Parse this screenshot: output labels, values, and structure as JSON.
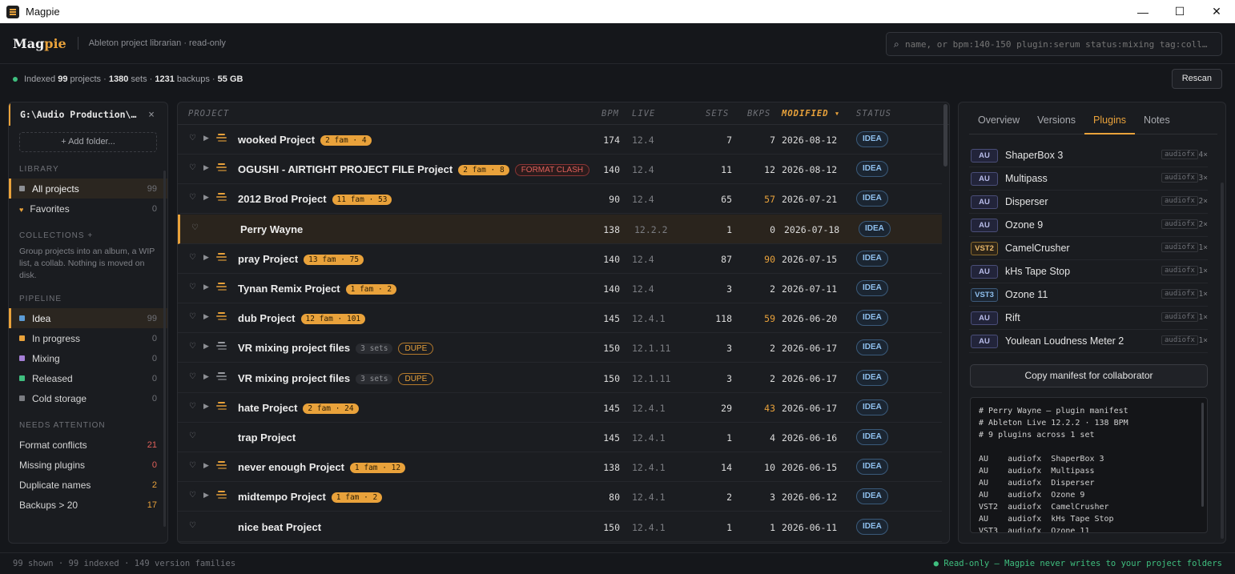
{
  "window": {
    "title": "Magpie",
    "minimize": "—",
    "maximize": "☐",
    "close": "✕"
  },
  "header": {
    "logo_main": "Mag",
    "logo_accent": "pie",
    "tagline": "Ableton project librarian · read-only",
    "search_placeholder": "name, or bpm:140-150 plugin:serum status:mixing tag:coll…"
  },
  "status": {
    "indexed_label": "Indexed",
    "projects": "99",
    "projects_label": "projects ·",
    "sets": "1380",
    "sets_label": "sets ·",
    "backups": "1231",
    "backups_label": "backups ·",
    "size": "55 GB",
    "rescan": "Rescan"
  },
  "sidebar": {
    "folder": "G:\\Audio Production\\…",
    "add_folder": "+ Add folder...",
    "library_head": "LIBRARY",
    "library": [
      {
        "label": "All projects",
        "count": "99"
      },
      {
        "label": "Favorites",
        "count": "0"
      }
    ],
    "collections_head": "COLLECTIONS +",
    "collections_desc": "Group projects into an album, a WIP list, a collab. Nothing is moved on disk.",
    "pipeline_head": "PIPELINE",
    "pipeline": [
      {
        "label": "Idea",
        "count": "99",
        "color": "#5b9bd5"
      },
      {
        "label": "In progress",
        "count": "0",
        "color": "#e9a23b"
      },
      {
        "label": "Mixing",
        "count": "0",
        "color": "#a57fd6"
      },
      {
        "label": "Released",
        "count": "0",
        "color": "#3fbf7f"
      },
      {
        "label": "Cold storage",
        "count": "0",
        "color": "#7b7d82"
      }
    ],
    "attention_head": "NEEDS ATTENTION",
    "attention": [
      {
        "label": "Format conflicts",
        "count": "21",
        "color": "#e0605a"
      },
      {
        "label": "Missing plugins",
        "count": "0",
        "color": "#e0605a"
      },
      {
        "label": "Duplicate names",
        "count": "2",
        "color": "#e9a23b"
      },
      {
        "label": "Backups > 20",
        "count": "17",
        "color": "#e9a23b"
      }
    ]
  },
  "table": {
    "columns": {
      "project": "PROJECT",
      "bpm": "BPM",
      "live": "LIVE",
      "sets": "SETS",
      "bkps": "BKPS",
      "modified": "MODIFIED ▾",
      "status": "STATUS"
    },
    "rows": [
      {
        "name": "wooked Project",
        "pill": "2 fam · 4",
        "pill_type": "fam",
        "bpm": "174",
        "live": "12.4",
        "sets": "7",
        "bkps": "7",
        "bkps_hi": false,
        "modified": "2026-08-12",
        "status": "IDEA",
        "caret": true,
        "stack": "orange"
      },
      {
        "name": "OGUSHI - AIRTIGHT PROJECT FILE Project",
        "pill": "2 fam · 8",
        "pill_type": "fam",
        "pill2": "FORMAT CLASH",
        "bpm": "140",
        "live": "12.4",
        "sets": "11",
        "bkps": "12",
        "bkps_hi": false,
        "modified": "2026-08-12",
        "status": "IDEA",
        "caret": true,
        "stack": "orange"
      },
      {
        "name": "2012 Brod Project",
        "pill": "11 fam · 53",
        "pill_type": "fam",
        "bpm": "90",
        "live": "12.4",
        "sets": "65",
        "bkps": "57",
        "bkps_hi": true,
        "modified": "2026-07-21",
        "status": "IDEA",
        "caret": true,
        "stack": "orange"
      },
      {
        "name": "Perry Wayne",
        "pill": "",
        "pill_type": "",
        "bpm": "138",
        "live": "12.2.2",
        "sets": "1",
        "bkps": "0",
        "bkps_hi": false,
        "modified": "2026-07-18",
        "status": "IDEA",
        "caret": false,
        "stack": "",
        "selected": true
      },
      {
        "name": "pray Project",
        "pill": "13 fam · 75",
        "pill_type": "fam",
        "bpm": "140",
        "live": "12.4",
        "sets": "87",
        "bkps": "90",
        "bkps_hi": true,
        "modified": "2026-07-15",
        "status": "IDEA",
        "caret": true,
        "stack": "orange"
      },
      {
        "name": "Tynan Remix Project",
        "pill": "1 fam · 2",
        "pill_type": "fam",
        "bpm": "140",
        "live": "12.4",
        "sets": "3",
        "bkps": "2",
        "bkps_hi": false,
        "modified": "2026-07-11",
        "status": "IDEA",
        "caret": true,
        "stack": "orange"
      },
      {
        "name": "dub Project",
        "pill": "12 fam · 101",
        "pill_type": "fam",
        "bpm": "145",
        "live": "12.4.1",
        "sets": "118",
        "bkps": "59",
        "bkps_hi": true,
        "modified": "2026-06-20",
        "status": "IDEA",
        "caret": true,
        "stack": "orange"
      },
      {
        "name": "VR mixing project files",
        "pill": "3 sets",
        "pill_type": "sets",
        "pill2": "DUPE",
        "bpm": "150",
        "live": "12.1.11",
        "sets": "3",
        "bkps": "2",
        "bkps_hi": false,
        "modified": "2026-06-17",
        "status": "IDEA",
        "caret": true,
        "stack": "gray"
      },
      {
        "name": "VR mixing project files",
        "pill": "3 sets",
        "pill_type": "sets",
        "pill2": "DUPE",
        "bpm": "150",
        "live": "12.1.11",
        "sets": "3",
        "bkps": "2",
        "bkps_hi": false,
        "modified": "2026-06-17",
        "status": "IDEA",
        "caret": true,
        "stack": "gray"
      },
      {
        "name": "hate Project",
        "pill": "2 fam · 24",
        "pill_type": "fam",
        "bpm": "145",
        "live": "12.4.1",
        "sets": "29",
        "bkps": "43",
        "bkps_hi": true,
        "modified": "2026-06-17",
        "status": "IDEA",
        "caret": true,
        "stack": "orange"
      },
      {
        "name": "trap Project",
        "pill": "",
        "pill_type": "",
        "bpm": "145",
        "live": "12.4.1",
        "sets": "1",
        "bkps": "4",
        "bkps_hi": false,
        "modified": "2026-06-16",
        "status": "IDEA",
        "caret": false,
        "stack": ""
      },
      {
        "name": "never enough Project",
        "pill": "1 fam · 12",
        "pill_type": "fam",
        "bpm": "138",
        "live": "12.4.1",
        "sets": "14",
        "bkps": "10",
        "bkps_hi": false,
        "modified": "2026-06-15",
        "status": "IDEA",
        "caret": true,
        "stack": "orange"
      },
      {
        "name": "midtempo Project",
        "pill": "1 fam · 2",
        "pill_type": "fam",
        "bpm": "80",
        "live": "12.4.1",
        "sets": "2",
        "bkps": "3",
        "bkps_hi": false,
        "modified": "2026-06-12",
        "status": "IDEA",
        "caret": true,
        "stack": "orange"
      },
      {
        "name": "nice beat Project",
        "pill": "",
        "pill_type": "",
        "bpm": "150",
        "live": "12.4.1",
        "sets": "1",
        "bkps": "1",
        "bkps_hi": false,
        "modified": "2026-06-11",
        "status": "IDEA",
        "caret": false,
        "stack": ""
      }
    ]
  },
  "details": {
    "tabs": [
      "Overview",
      "Versions",
      "Plugins",
      "Notes"
    ],
    "active_tab": "Plugins",
    "plugins": [
      {
        "format": "AU",
        "name": "ShaperBox 3",
        "category": "audiofx",
        "count": "4×"
      },
      {
        "format": "AU",
        "name": "Multipass",
        "category": "audiofx",
        "count": "3×"
      },
      {
        "format": "AU",
        "name": "Disperser",
        "category": "audiofx",
        "count": "2×"
      },
      {
        "format": "AU",
        "name": "Ozone 9",
        "category": "audiofx",
        "count": "2×"
      },
      {
        "format": "VST2",
        "name": "CamelCrusher",
        "category": "audiofx",
        "count": "1×"
      },
      {
        "format": "AU",
        "name": "kHs Tape Stop",
        "category": "audiofx",
        "count": "1×"
      },
      {
        "format": "VST3",
        "name": "Ozone 11",
        "category": "audiofx",
        "count": "1×"
      },
      {
        "format": "AU",
        "name": "Rift",
        "category": "audiofx",
        "count": "1×"
      },
      {
        "format": "AU",
        "name": "Youlean Loudness Meter 2",
        "category": "audiofx",
        "count": "1×"
      }
    ],
    "copy_button": "Copy manifest for collaborator",
    "manifest": [
      "# Perry Wayne — plugin manifest",
      "# Ableton Live 12.2.2 · 138 BPM",
      "# 9 plugins across 1 set",
      "",
      "AU    audiofx  ShaperBox 3",
      "AU    audiofx  Multipass",
      "AU    audiofx  Disperser",
      "AU    audiofx  Ozone 9",
      "VST2  audiofx  CamelCrusher",
      "AU    audiofx  kHs Tape Stop",
      "VST3  audiofx  Ozone 11"
    ]
  },
  "footer": {
    "left": "99 shown · 99 indexed · 149 version families",
    "right": "● Read-only — Magpie never writes to your project folders"
  }
}
